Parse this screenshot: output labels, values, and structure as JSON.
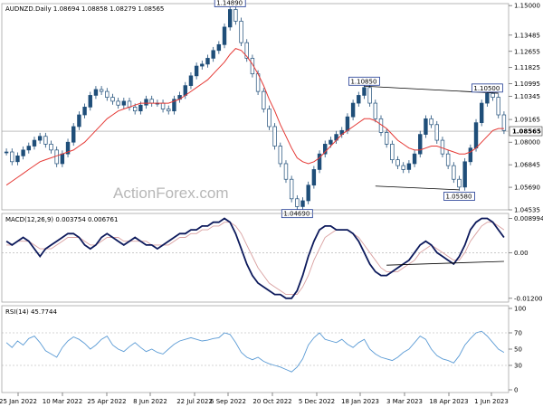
{
  "chart_data": {
    "type": "candlestick",
    "header": "AUDNZD.Daily  1.08694 1.08858 1.08279 1.08565",
    "watermark": "ActionForex.com",
    "x_labels": [
      "25 Jan 2022",
      "10 Mar 2022",
      "25 Apr 2022",
      "8 Jun 2022",
      "22 Jul 2022",
      "6 Sep 2022",
      "20 Oct 2022",
      "5 Dec 2022",
      "18 Jan 2023",
      "3 Mar 2023",
      "18 Apr 2023",
      "1 Jun 2023"
    ],
    "price": {
      "ylim": [
        1.04535,
        1.151
      ],
      "ticks": [
        "1.15000",
        "1.13485",
        "1.12655",
        "1.11825",
        "1.10995",
        "1.10345",
        "1.09165",
        "1.08000",
        "1.06845",
        "1.05690",
        "1.04535"
      ],
      "ticks_values": [
        1.15,
        1.13485,
        1.12655,
        1.11825,
        1.10995,
        1.10345,
        1.09165,
        1.08,
        1.06845,
        1.0569,
        1.04535
      ],
      "last": "1.08565",
      "last_value": 1.08565,
      "flags": [
        "1.14890",
        "1.10850",
        "1.10500",
        "1.04690",
        "1.05580"
      ],
      "close": [
        1.075,
        1.07,
        1.073,
        1.076,
        1.078,
        1.081,
        1.083,
        1.079,
        1.076,
        1.069,
        1.074,
        1.08,
        1.088,
        1.094,
        1.098,
        1.104,
        1.107,
        1.106,
        1.103,
        1.101,
        1.099,
        1.101,
        1.098,
        1.096,
        1.099,
        1.102,
        1.1,
        1.1,
        1.097,
        1.096,
        1.102,
        1.104,
        1.109,
        1.114,
        1.119,
        1.12,
        1.123,
        1.127,
        1.13,
        1.139,
        1.148,
        1.142,
        1.131,
        1.123,
        1.115,
        1.106,
        1.097,
        1.088,
        1.078,
        1.069,
        1.061,
        1.051,
        1.047,
        1.05,
        1.058,
        1.066,
        1.074,
        1.079,
        1.081,
        1.084,
        1.086,
        1.093,
        1.1,
        1.104,
        1.108,
        1.1,
        1.092,
        1.085,
        1.079,
        1.071,
        1.068,
        1.066,
        1.069,
        1.074,
        1.084,
        1.092,
        1.089,
        1.081,
        1.074,
        1.068,
        1.061,
        1.057,
        1.07,
        1.077,
        1.09,
        1.1,
        1.105,
        1.103,
        1.094,
        1.086
      ],
      "ma": [
        1.058,
        1.06,
        1.062,
        1.064,
        1.066,
        1.068,
        1.07,
        1.071,
        1.072,
        1.073,
        1.074,
        1.075,
        1.076,
        1.078,
        1.08,
        1.083,
        1.086,
        1.089,
        1.092,
        1.094,
        1.096,
        1.097,
        1.098,
        1.099,
        1.1,
        1.1,
        1.1,
        1.1,
        1.1,
        1.1,
        1.101,
        1.102,
        1.104,
        1.106,
        1.108,
        1.11,
        1.112,
        1.115,
        1.118,
        1.121,
        1.125,
        1.128,
        1.127,
        1.124,
        1.12,
        1.115,
        1.109,
        1.102,
        1.096,
        1.089,
        1.083,
        1.077,
        1.072,
        1.07,
        1.069,
        1.07,
        1.072,
        1.075,
        1.078,
        1.081,
        1.084,
        1.086,
        1.088,
        1.09,
        1.092,
        1.092,
        1.091,
        1.089,
        1.087,
        1.084,
        1.081,
        1.079,
        1.077,
        1.076,
        1.076,
        1.077,
        1.078,
        1.078,
        1.077,
        1.076,
        1.075,
        1.074,
        1.074,
        1.075,
        1.077,
        1.08,
        1.083,
        1.086,
        1.087,
        1.087
      ]
    },
    "macd": {
      "label": "MACD(12,26,9) 0.003754 0.006761",
      "ylim": [
        -0.013,
        0.0103
      ],
      "ticks": [
        "0.008994",
        "0.00",
        "-0.012008"
      ],
      "ticks_values": [
        0.008994,
        0.0,
        -0.012008
      ],
      "main": [
        0.003,
        0.002,
        0.003,
        0.004,
        0.003,
        0.001,
        -0.001,
        0.001,
        0.002,
        0.003,
        0.004,
        0.005,
        0.005,
        0.004,
        0.002,
        0.001,
        0.002,
        0.004,
        0.005,
        0.004,
        0.003,
        0.002,
        0.003,
        0.004,
        0.003,
        0.002,
        0.002,
        0.001,
        0.002,
        0.003,
        0.004,
        0.005,
        0.005,
        0.006,
        0.006,
        0.007,
        0.007,
        0.008,
        0.008,
        0.009,
        0.008,
        0.005,
        0.001,
        -0.003,
        -0.006,
        -0.008,
        -0.009,
        -0.01,
        -0.011,
        -0.011,
        -0.012,
        -0.012,
        -0.01,
        -0.006,
        -0.001,
        0.003,
        0.006,
        0.007,
        0.007,
        0.006,
        0.006,
        0.006,
        0.005,
        0.003,
        0.0,
        -0.003,
        -0.005,
        -0.006,
        -0.006,
        -0.005,
        -0.004,
        -0.003,
        -0.002,
        0.0,
        0.002,
        0.003,
        0.002,
        0.0,
        -0.001,
        -0.002,
        -0.003,
        -0.001,
        0.002,
        0.006,
        0.008,
        0.009,
        0.009,
        0.008,
        0.006,
        0.004
      ],
      "signal": [
        0.002,
        0.002,
        0.003,
        0.003,
        0.003,
        0.002,
        0.001,
        0.001,
        0.001,
        0.002,
        0.003,
        0.004,
        0.004,
        0.004,
        0.003,
        0.002,
        0.002,
        0.003,
        0.004,
        0.004,
        0.004,
        0.003,
        0.003,
        0.003,
        0.003,
        0.003,
        0.002,
        0.002,
        0.002,
        0.002,
        0.003,
        0.004,
        0.004,
        0.005,
        0.005,
        0.006,
        0.006,
        0.007,
        0.007,
        0.008,
        0.008,
        0.007,
        0.005,
        0.002,
        -0.001,
        -0.004,
        -0.006,
        -0.008,
        -0.009,
        -0.01,
        -0.011,
        -0.011,
        -0.011,
        -0.009,
        -0.006,
        -0.002,
        0.001,
        0.004,
        0.005,
        0.006,
        0.006,
        0.006,
        0.005,
        0.004,
        0.002,
        0.0,
        -0.002,
        -0.004,
        -0.005,
        -0.005,
        -0.005,
        -0.004,
        -0.003,
        -0.002,
        0.0,
        0.001,
        0.002,
        0.001,
        0.0,
        -0.001,
        -0.002,
        -0.002,
        0.0,
        0.003,
        0.005,
        0.007,
        0.008,
        0.008,
        0.007,
        0.006
      ],
      "trend_from": [
        0.0,
        -0.0033
      ],
      "trend_to": [
        0.0,
        -0.0023
      ]
    },
    "rsi": {
      "label": "RSI(14) 45.7744",
      "ylim": [
        0,
        100
      ],
      "ticks": [
        "100",
        "70",
        "50",
        "30",
        "0"
      ],
      "ticks_values": [
        100,
        70,
        50,
        30,
        0
      ],
      "values": [
        58,
        52,
        60,
        55,
        63,
        66,
        58,
        48,
        44,
        40,
        52,
        60,
        65,
        62,
        57,
        50,
        55,
        62,
        66,
        55,
        50,
        47,
        53,
        58,
        52,
        47,
        50,
        46,
        44,
        50,
        56,
        60,
        62,
        64,
        62,
        60,
        61,
        63,
        64,
        70,
        68,
        58,
        46,
        40,
        37,
        40,
        35,
        32,
        30,
        28,
        25,
        22,
        28,
        38,
        55,
        64,
        70,
        62,
        60,
        58,
        62,
        56,
        52,
        58,
        62,
        50,
        44,
        40,
        38,
        36,
        40,
        46,
        50,
        58,
        66,
        62,
        50,
        42,
        38,
        36,
        33,
        42,
        55,
        63,
        70,
        72,
        66,
        58,
        50,
        46
      ]
    },
    "colors": {
      "candle": "#1f4e79",
      "ma": "#e53935",
      "macd": "#0d1a5c",
      "signal": "#d9a0a0",
      "rsi": "#5b9bd5"
    }
  }
}
